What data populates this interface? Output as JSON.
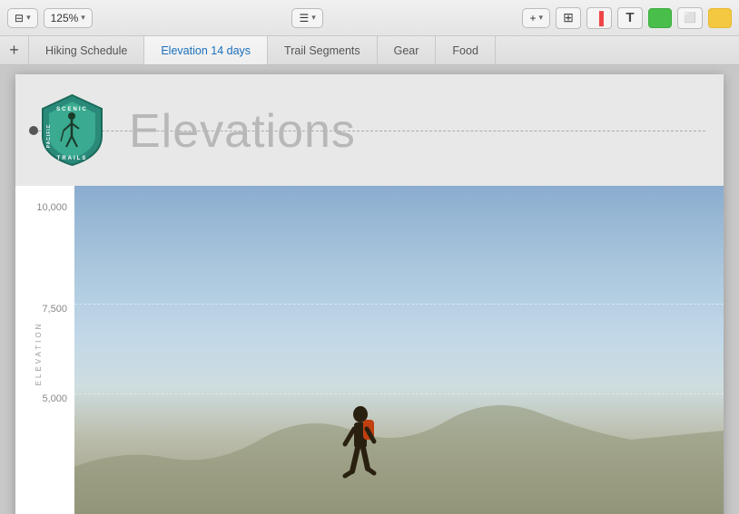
{
  "toolbar": {
    "view_btn": "125%",
    "view_icon": "⊟",
    "view_chevron": "▾",
    "zoom_chevron": "▾",
    "list_icon": "☰",
    "list_chevron": "▾",
    "insert_plus": "+",
    "insert_chevron": "▾",
    "table_icon": "⊞",
    "chart_icon": "▐",
    "text_icon": "T",
    "shape_color": "#4abe4a",
    "image_icon": "⬜",
    "comment_color": "#f5c842"
  },
  "tabs": [
    {
      "id": "hiking-schedule",
      "label": "Hiking Schedule",
      "active": false
    },
    {
      "id": "elevation-14-days",
      "label": "Elevation 14 days",
      "active": true
    },
    {
      "id": "trail-segments",
      "label": "Trail Segments",
      "active": false
    },
    {
      "id": "gear",
      "label": "Gear",
      "active": false
    },
    {
      "id": "food",
      "label": "Food",
      "active": false
    }
  ],
  "page": {
    "title": "Elevations",
    "logo_text_top": "SCENIC",
    "logo_text_bottom": "TRAILS",
    "logo_text_left": "PACIFIC"
  },
  "chart": {
    "y_labels": [
      "10,000",
      "7,500",
      "5,000"
    ],
    "y_axis_title": "ELEVATION",
    "title": "ELEVATION"
  }
}
